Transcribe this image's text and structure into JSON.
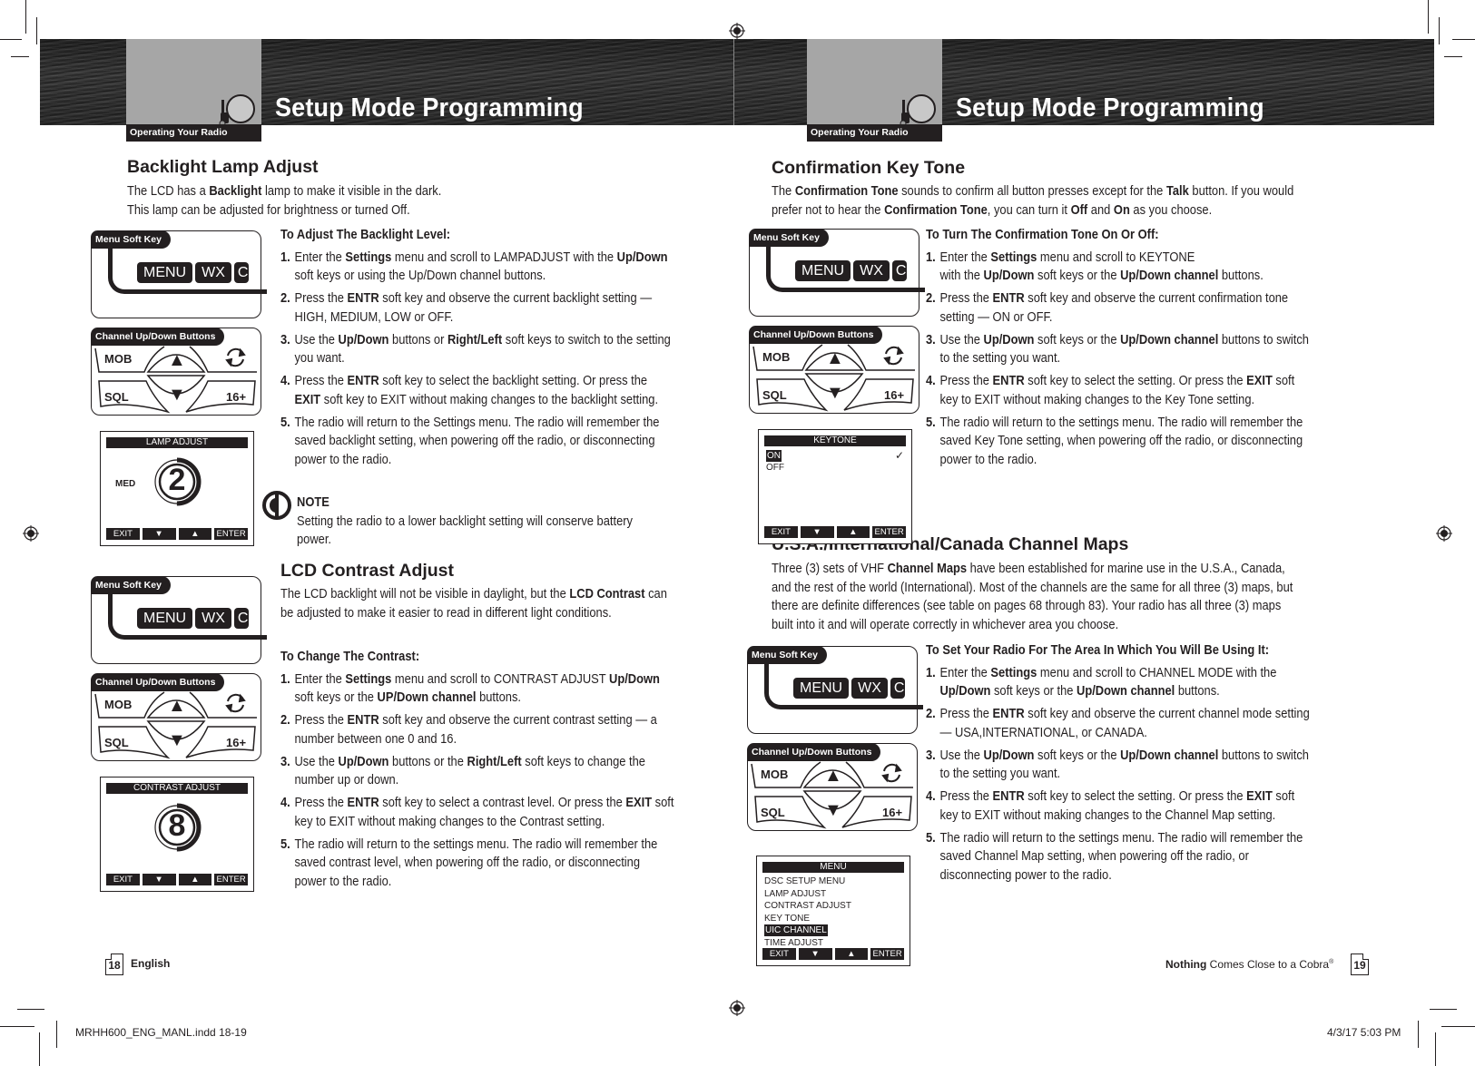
{
  "header": {
    "section_tab": "Operating Your Radio",
    "title": "Setup Mode Programming"
  },
  "left_page": {
    "backlight": {
      "heading": "Backlight Lamp Adjust",
      "intro": [
        "The LCD has a ",
        "Backlight",
        " lamp to make it visible in the dark.",
        "This lamp can be adjusted for brightness or turned Off."
      ],
      "proc_heading": "To Adjust The Backlight Level:",
      "steps": [
        {
          "n": "1.",
          "html": "Enter the <b>Settings</b> menu and scroll to LAMPADJUST with the <b>Up/Down</b> soft keys or using the Up/Down channel buttons."
        },
        {
          "n": "2.",
          "html": "Press the <b>ENTR</b> soft key and observe the current backlight setting — HIGH, MEDIUM, LOW or OFF."
        },
        {
          "n": "3.",
          "html": "Use the <b>Up/Down</b> buttons or <b>Right/Left</b> soft keys to switch to the setting you want."
        },
        {
          "n": "4.",
          "html": "Press the <b>ENTR</b> soft key to select the backlight setting. Or press the <b>EXIT</b> soft key to EXIT without making changes to the backlight setting."
        },
        {
          "n": "5.",
          "html": "The radio will return to the Settings menu. The radio will remember the saved backlight setting, when powering off the radio, or disconnecting power to the radio."
        }
      ],
      "note_title": "NOTE",
      "note_text": "Setting the radio to a lower backlight setting will conserve battery power.",
      "lcd": {
        "title": "LAMP ADJUST",
        "side_label": "MED",
        "value": "2",
        "level_fraction": 0.5
      }
    },
    "contrast": {
      "heading": "LCD Contrast Adjust",
      "intro_html": "The LCD backlight will not be visible in daylight, but the <b>LCD Contrast</b> can be adjusted to make it easier to read in different light conditions.",
      "proc_heading": "To Change The Contrast:",
      "steps": [
        {
          "n": "1.",
          "html": "Enter the <b>Settings</b> menu and scroll to CONTRAST ADJUST <b>Up/Down</b> soft keys or the <b>UP/Down channel</b> buttons."
        },
        {
          "n": "2.",
          "html": "Press the <b>ENTR</b> soft key and observe the current contrast setting — a number between one 0 and 16."
        },
        {
          "n": "3.",
          "html": "Use the <b>Up/Down</b> buttons or the <b>Right/Left</b> soft keys to change the number up or down."
        },
        {
          "n": "4.",
          "html": "Press the <b>ENTR</b> soft key to select a contrast level. Or press the <b>EXIT</b> soft key to EXIT without making changes to the Contrast setting."
        },
        {
          "n": "5.",
          "html": "The radio will return to the settings menu. The radio will remember the saved contrast level, when powering off the radio, or disconnecting power to the radio."
        }
      ],
      "lcd": {
        "title": "CONTRAST ADJUST",
        "value": "8",
        "level_fraction": 0.5
      }
    },
    "footer": {
      "page": "18",
      "label": "English"
    }
  },
  "right_page": {
    "keytone": {
      "heading": "Confirmation Key Tone",
      "intro_html": "The <b>Confirmation Tone</b> sounds to confirm all button presses except for the <b>Talk</b> button. If you would prefer not to hear the <b>Confirmation Tone</b>, you can turn it <b>Off</b> and <b>On</b> as you choose.",
      "proc_heading": "To Turn The Confirmation Tone On Or Off:",
      "steps": [
        {
          "n": "1.",
          "html": "Enter the <b>Settings</b> menu and scroll to KEYTONE<br>with the <b>Up/Down</b> soft keys or the <b>Up/Down channel</b> buttons."
        },
        {
          "n": "2.",
          "html": "Press the <b>ENTR</b> soft key and observe the current confirmation tone setting — ON or OFF."
        },
        {
          "n": "3.",
          "html": "Use the <b>Up/Down</b> soft keys or the <b>Up/Down channel</b> buttons to switch to the setting you want."
        },
        {
          "n": "4.",
          "html": "Press the <b>ENTR</b> soft key to select the setting. Or press the <b>EXIT</b> soft key to EXIT without making changes to the Key Tone setting."
        },
        {
          "n": "5.",
          "html": "The radio will return to the settings menu. The radio will remember the saved Key Tone setting, when powering off the radio, or disconnecting power to the radio."
        }
      ],
      "lcd": {
        "title": "KEYTONE",
        "options": [
          "ON",
          "OFF"
        ],
        "selected": "ON"
      }
    },
    "channel_maps": {
      "heading": "U.S.A./International/Canada Channel Maps",
      "intro_html": "Three (3) sets of VHF <b>Channel Maps</b> have been established for marine use in the U.S.A., Canada, and the rest of the world (International). Most of the channels are the same for all three (3) maps, but there are definite differences (see table on pages 68 through 83). Your radio has all three (3) maps built into it and will operate correctly in whichever area you choose.",
      "proc_heading": "To Set Your Radio For The Area In Which You Will Be Using It:",
      "steps": [
        {
          "n": "1.",
          "html": "Enter the <b>Settings</b> menu and scroll to CHANNEL MODE with the <b>Up/Down</b> soft keys or the <b>Up/Down channel</b> buttons."
        },
        {
          "n": "2.",
          "html": "Press the <b>ENTR</b> soft key and observe the current channel mode setting — USA,INTERNATIONAL, or CANADA."
        },
        {
          "n": "3.",
          "html": "Use the <b>Up/Down</b> soft keys or the <b>Up/Down channel</b> buttons to switch to the setting you want."
        },
        {
          "n": "4.",
          "html": "Press the <b>ENTR</b> soft key to select the setting. Or press the <b>EXIT</b> soft key to EXIT without making changes to the Channel Map setting."
        },
        {
          "n": "5.",
          "html": "The radio will return to the settings menu. The radio will remember the saved Channel Map setting, when powering off the radio, or disconnecting power to the radio."
        }
      ],
      "lcd": {
        "title": "MENU",
        "items": [
          "DSC SETUP MENU",
          "LAMP ADJUST",
          "CONTRAST ADJUST",
          "KEY TONE",
          "UIC CHANNEL",
          "TIME ADJUST"
        ],
        "selected": "UIC CHANNEL"
      }
    },
    "footer": {
      "tagline_bold": "Nothing",
      "tagline_rest": " Comes Close to a Cobra",
      "registered": "®",
      "page": "19"
    }
  },
  "device": {
    "menu_soft_key_label": "Menu Soft Key",
    "menu_keys": [
      "MENU",
      "WX",
      "C"
    ],
    "channel_buttons_label": "Channel Up/Down Buttons",
    "channel_keys": {
      "mob": "MOB",
      "sql": "SQL",
      "ch16": "16+",
      "up": "▲",
      "down": "▼"
    },
    "softkeys": [
      "EXIT",
      "▼",
      "▲",
      "ENTER"
    ]
  },
  "slug": {
    "file": "MRHH600_ENG_MANL.indd   18-19",
    "date": "4/3/17   5:03 PM"
  }
}
